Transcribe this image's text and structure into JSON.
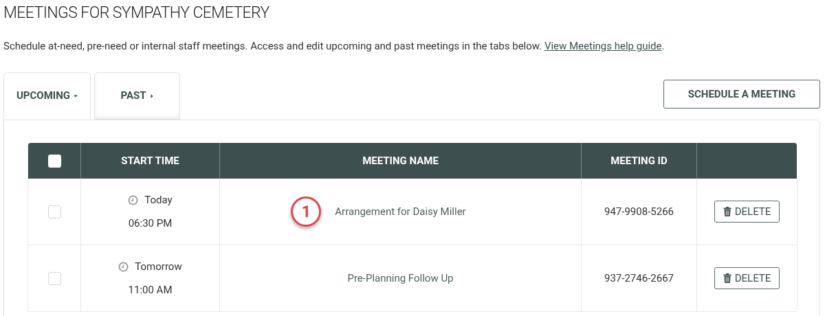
{
  "title": "MEETINGS FOR SYMPATHY CEMETERY",
  "description": "Schedule at-need, pre-need or internal staff meetings. Access and edit upcoming and past meetings in the tabs below.",
  "help_link": "View Meetings help guide",
  "description_end": ".",
  "tabs": [
    {
      "label": "UPCOMING",
      "selected": true
    },
    {
      "label": "PAST",
      "selected": false
    }
  ],
  "schedule_button": "SCHEDULE A MEETING",
  "table": {
    "select_all_checked": false,
    "columns": [
      "START TIME",
      "MEETING NAME",
      "MEETING ID"
    ],
    "rows": [
      {
        "checked": false,
        "day": "Today",
        "time": "06:30 PM",
        "name": "Arrangement for Daisy Miller",
        "callout": "1",
        "meeting_id": "947-9908-5266",
        "action": "DELETE"
      },
      {
        "checked": false,
        "day": "Tomorrow",
        "time": "11:00 AM",
        "name": "Pre-Planning Follow Up",
        "meeting_id": "937-2746-2667",
        "action": "DELETE"
      }
    ]
  }
}
